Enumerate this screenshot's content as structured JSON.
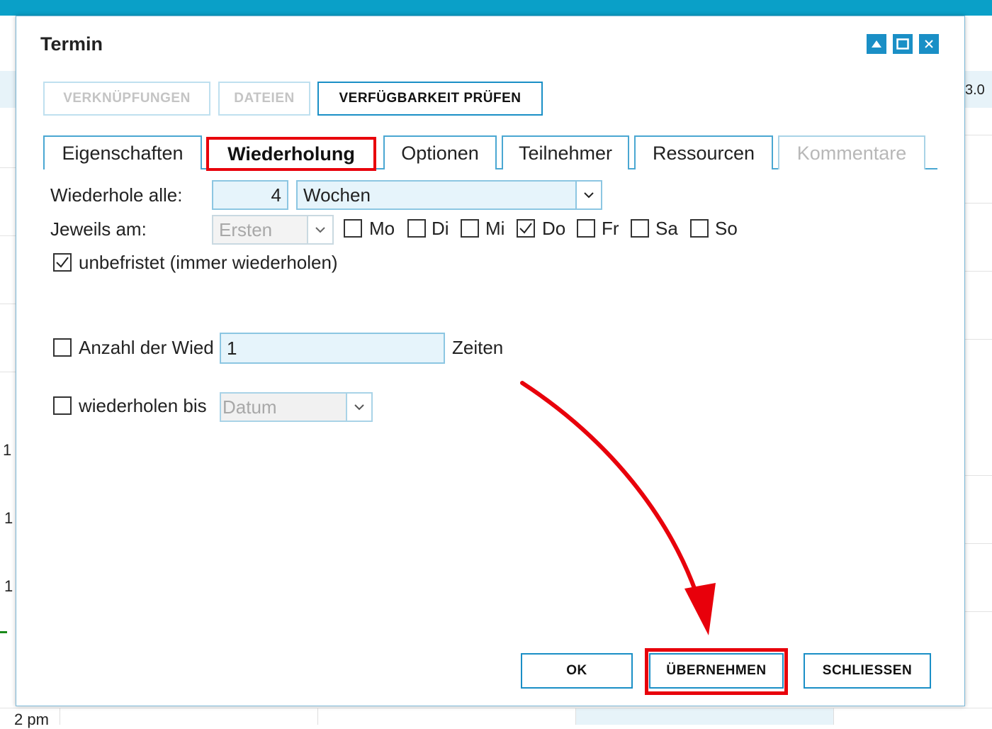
{
  "background": {
    "partial_date": "3.0",
    "time_marks": [
      "1",
      "1",
      "1"
    ],
    "bottom_time": "2 pm"
  },
  "dialog": {
    "title": "Termin",
    "window_controls": [
      "restore-icon",
      "maximize-icon",
      "close-icon"
    ],
    "top_buttons": {
      "links_label": "VERKNÜPFUNGEN",
      "files_label": "DATEIEN",
      "availability_label": "VERFÜGBARKEIT PRÜFEN"
    },
    "tabs": [
      {
        "label": "Eigenschaften",
        "state": "normal"
      },
      {
        "label": "Wiederholung",
        "state": "selected"
      },
      {
        "label": "Optionen",
        "state": "normal"
      },
      {
        "label": "Teilnehmer",
        "state": "normal"
      },
      {
        "label": "Ressourcen",
        "state": "normal"
      },
      {
        "label": "Kommentare",
        "state": "disabled"
      }
    ],
    "repeat": {
      "every_label": "Wiederhole alle:",
      "every_value": "4",
      "unit_value": "Wochen",
      "on_label": "Jeweils am:",
      "on_select_value": "Ersten",
      "days": [
        {
          "label": "Mo",
          "checked": false
        },
        {
          "label": "Di",
          "checked": false
        },
        {
          "label": "Mi",
          "checked": false
        },
        {
          "label": "Do",
          "checked": true
        },
        {
          "label": "Fr",
          "checked": false
        },
        {
          "label": "Sa",
          "checked": false
        },
        {
          "label": "So",
          "checked": false
        }
      ],
      "unlimited_label": "unbefristet (immer wiederholen)",
      "unlimited_checked": true,
      "count_label": "Anzahl der Wied",
      "count_value": "1",
      "count_suffix": "Zeiten",
      "count_checked": false,
      "until_label": "wiederholen bis",
      "until_placeholder": "Datum",
      "until_checked": false
    },
    "footer": {
      "ok_label": "OK",
      "apply_label": "ÜBERNEHMEN",
      "close_label": "SCHLIESSEN"
    }
  },
  "annotations": {
    "highlight_color": "#e8000b",
    "highlighted": [
      "tab-wiederholung",
      "apply-button"
    ],
    "arrow_target": "apply-button"
  }
}
